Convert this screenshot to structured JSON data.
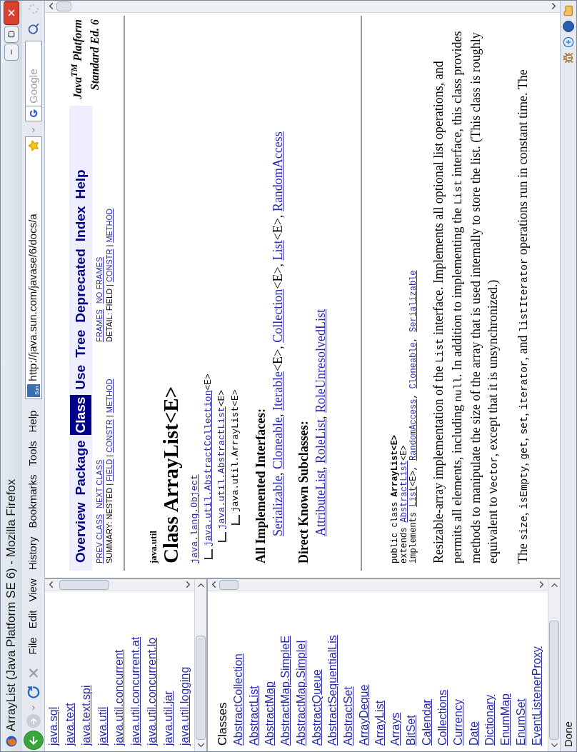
{
  "window": {
    "title": "ArrayList (Java Platform SE 6) - Mozilla Firefox"
  },
  "menu": [
    "File",
    "Edit",
    "View",
    "History",
    "Bookmarks",
    "Tools",
    "Help"
  ],
  "address": {
    "favicon_text": "Sun",
    "value": "http://java.sun.com/javase/6/docs/a"
  },
  "search": {
    "placeholder": "Google"
  },
  "packages": [
    "java.sql",
    "java.text",
    "java.text.spi",
    "java.util",
    "java.util.concurrent",
    "java.util.concurrent.at",
    "java.util.concurrent.lo",
    "java.util.jar",
    "java.util.logging"
  ],
  "classes": {
    "heading": "Classes",
    "items": [
      "AbstractCollection",
      "AbstractList",
      "AbstractMap",
      "AbstractMap.SimpleE",
      "AbstractMap.SimpleI",
      "AbstractQueue",
      "AbstractSequentialLis",
      "AbstractSet",
      "ArrayDeque",
      "ArrayList",
      "Arrays",
      "BitSet",
      "Calendar",
      "Collections",
      "Currency",
      "Date",
      "Dictionary",
      "EnumMap",
      "EnumSet",
      "EventListenerProxy"
    ]
  },
  "nav": {
    "items": [
      {
        "label": "Overview",
        "selected": false
      },
      {
        "label": "Package",
        "selected": false
      },
      {
        "label": "Class",
        "selected": true
      },
      {
        "label": "Use",
        "selected": false
      },
      {
        "label": "Tree",
        "selected": false
      },
      {
        "label": "Deprecated",
        "selected": false
      },
      {
        "label": "Index",
        "selected": false
      },
      {
        "label": "Help",
        "selected": false
      }
    ],
    "platform": [
      "Java$^{TM}$ Platform",
      "Standard Ed. 6"
    ],
    "subnav_left": [
      [
        {
          "text": "PREV CLASS",
          "kind": "link"
        },
        {
          "text": "NEXT CLASS",
          "kind": "link"
        }
      ],
      [
        {
          "text": "SUMMARY: NESTED | ",
          "kind": "text"
        },
        {
          "text": "FIELD",
          "kind": "link"
        },
        {
          "text": " | ",
          "kind": "text"
        },
        {
          "text": "CONSTR",
          "kind": "link"
        },
        {
          "text": " | ",
          "kind": "text"
        },
        {
          "text": "METHOD",
          "kind": "link"
        }
      ]
    ],
    "subnav_right": [
      [
        {
          "text": "FRAMES",
          "kind": "link"
        },
        {
          "text": "NO FRAMES",
          "kind": "link"
        }
      ],
      [
        {
          "text": "DETAIL: FIELD | ",
          "kind": "text"
        },
        {
          "text": "CONSTR",
          "kind": "link"
        },
        {
          "text": " | ",
          "kind": "text"
        },
        {
          "text": "METHOD",
          "kind": "link"
        }
      ]
    ]
  },
  "package_name": "java.util",
  "class_title": "Class ArrayList<E>",
  "hierarchy": {
    "name": "java.lang.Object",
    "current": false,
    "children": [
      {
        "name": "java.util.AbstractCollection",
        "params": "<E>",
        "current": false,
        "children": [
          {
            "name": "java.util.AbstractList",
            "params": "<E>",
            "current": false,
            "children": [
              {
                "name": "java.util.ArrayList",
                "params": "<E>",
                "current": true
              }
            ]
          }
        ]
      }
    ]
  },
  "interfaces": {
    "heading": "All Implemented Interfaces:",
    "items": [
      {
        "text": "Serializable",
        "kind": "link"
      },
      {
        "text": ", ",
        "kind": "text"
      },
      {
        "text": "Cloneable",
        "kind": "link"
      },
      {
        "text": ", ",
        "kind": "text"
      },
      {
        "text": "Iterable",
        "kind": "link"
      },
      {
        "text": "<E>, ",
        "kind": "text"
      },
      {
        "text": "Collection",
        "kind": "link"
      },
      {
        "text": "<E>, ",
        "kind": "text"
      },
      {
        "text": "List",
        "kind": "link"
      },
      {
        "text": "<E>, ",
        "kind": "text"
      },
      {
        "text": "RandomAccess",
        "kind": "link"
      }
    ]
  },
  "subclasses": {
    "heading": "Direct Known Subclasses:",
    "items": [
      {
        "text": "AttributeList",
        "kind": "link"
      },
      {
        "text": ", ",
        "kind": "text"
      },
      {
        "text": "RoleList",
        "kind": "link"
      },
      {
        "text": ", ",
        "kind": "text"
      },
      {
        "text": "RoleUnresolvedList",
        "kind": "link"
      }
    ]
  },
  "declaration": [
    [
      {
        "text": "public class ",
        "kind": "code"
      },
      {
        "text": "ArrayList<E>",
        "kind": "code-bold"
      }
    ],
    [
      {
        "text": "extends ",
        "kind": "code"
      },
      {
        "text": "AbstractList",
        "kind": "code-link"
      },
      {
        "text": "<E>",
        "kind": "code"
      }
    ],
    [
      {
        "text": "implements ",
        "kind": "code"
      },
      {
        "text": "List",
        "kind": "code-link"
      },
      {
        "text": "<E>, ",
        "kind": "code"
      },
      {
        "text": "RandomAccess",
        "kind": "code-link"
      },
      {
        "text": ", ",
        "kind": "code"
      },
      {
        "text": "Cloneable",
        "kind": "code-link"
      },
      {
        "text": ", ",
        "kind": "code"
      },
      {
        "text": "Serializable",
        "kind": "code-link"
      }
    ]
  ],
  "description": [
    [
      {
        "text": "Resizable-array implementation of the ",
        "kind": "text"
      },
      {
        "text": "List",
        "kind": "code"
      },
      {
        "text": " interface. Implements all optional list operations, and permits all elements, including ",
        "kind": "text"
      },
      {
        "text": "null",
        "kind": "code"
      },
      {
        "text": ". In addition to implementing the ",
        "kind": "text"
      },
      {
        "text": "List",
        "kind": "code"
      },
      {
        "text": " interface, this class provides methods to manipulate the size of the array that is used internally to store the list. (This class is roughly equivalent to ",
        "kind": "text"
      },
      {
        "text": "Vector",
        "kind": "code"
      },
      {
        "text": ", except that it is unsynchronized.)",
        "kind": "text"
      }
    ],
    [
      {
        "text": "The ",
        "kind": "text"
      },
      {
        "text": "size",
        "kind": "code"
      },
      {
        "text": ", ",
        "kind": "text"
      },
      {
        "text": "isEmpty",
        "kind": "code"
      },
      {
        "text": ", ",
        "kind": "text"
      },
      {
        "text": "get",
        "kind": "code"
      },
      {
        "text": ", ",
        "kind": "text"
      },
      {
        "text": "set",
        "kind": "code"
      },
      {
        "text": ", ",
        "kind": "text"
      },
      {
        "text": "iterator",
        "kind": "code"
      },
      {
        "text": ", and ",
        "kind": "text"
      },
      {
        "text": "listIterator",
        "kind": "code"
      },
      {
        "text": " operations run in constant time. The",
        "kind": "text"
      }
    ]
  ],
  "status": "Done"
}
